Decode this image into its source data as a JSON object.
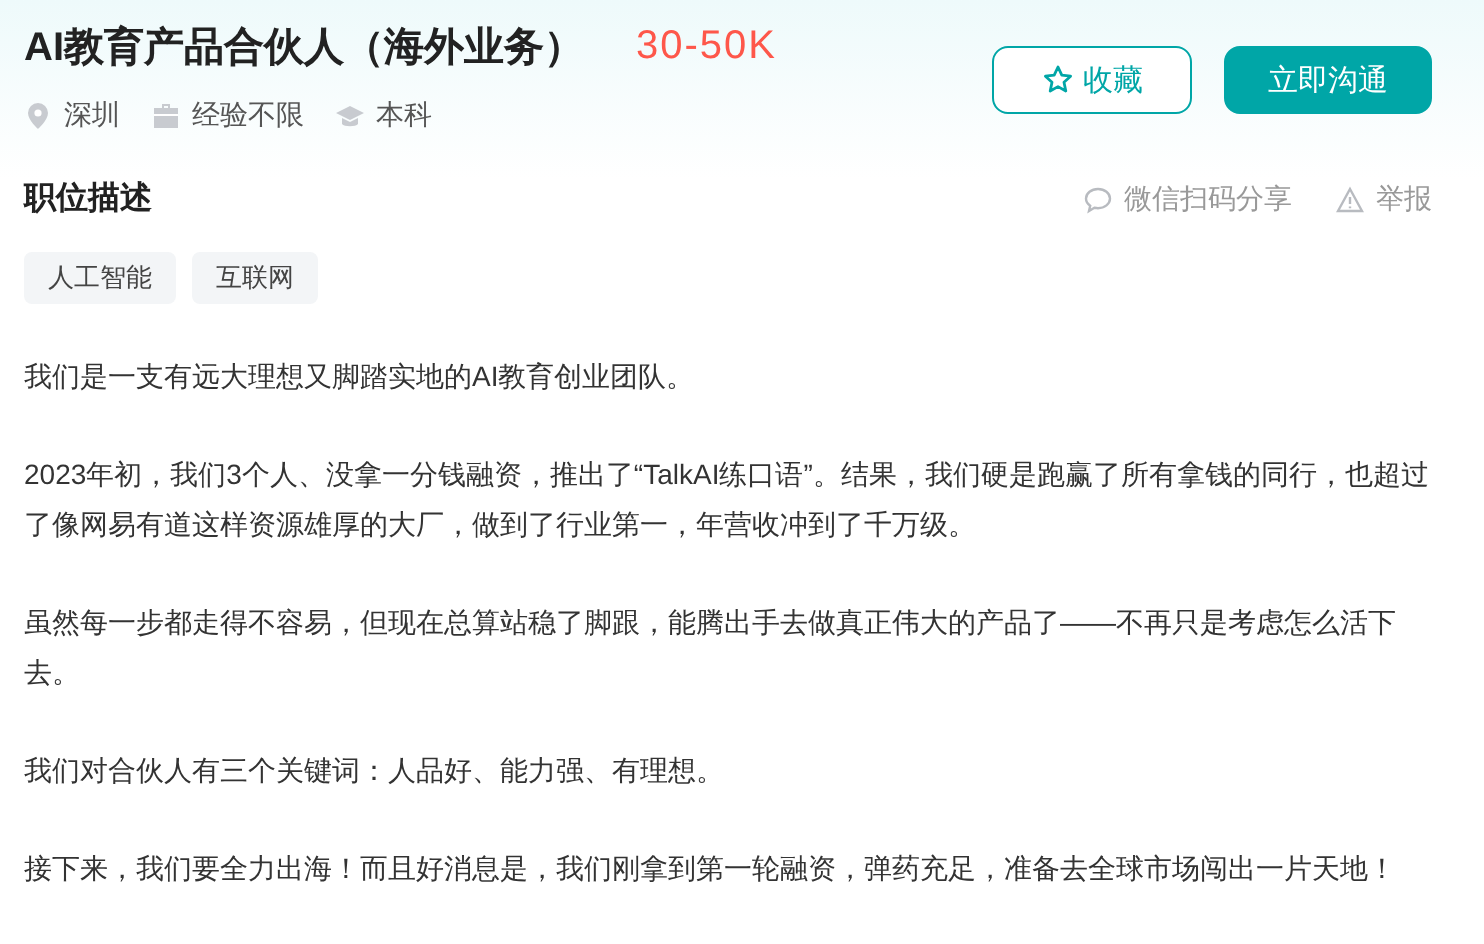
{
  "job": {
    "title": "AI教育产品合伙人（海外业务）",
    "salary": "30-50K",
    "meta": [
      {
        "kind": "location",
        "label": "深圳"
      },
      {
        "kind": "experience",
        "label": "经验不限"
      },
      {
        "kind": "degree",
        "label": "本科"
      }
    ]
  },
  "actions": [
    {
      "kind": "favorite",
      "label": "收藏"
    },
    {
      "kind": "chat",
      "label": "立即沟通"
    }
  ],
  "section": {
    "title": "职位描述",
    "links": [
      {
        "kind": "share",
        "label": "微信扫码分享"
      },
      {
        "kind": "report",
        "label": "举报"
      }
    ]
  },
  "tags": [
    "人工智能",
    "互联网"
  ],
  "paragraphs": [
    "我们是一支有远大理想又脚踏实地的AI教育创业团队。",
    "2023年初，我们3个人、没拿一分钱融资，推出了“TalkAI练口语”。结果，我们硬是跑赢了所有拿钱的同行，也超过了像网易有道这样资源雄厚的大厂，做到了行业第一，年营收冲到了千万级。",
    "虽然每一步都走得不容易，但现在总算站稳了脚跟，能腾出手去做真正伟大的产品了——不再只是考虑怎么活下去。",
    "我们对合伙人有三个关键词：人品好、能力强、有理想。",
    "接下来，我们要全力出海！而且好消息是，我们刚拿到第一轮融资，弹药充足，准备去全球市场闯出一片天地！"
  ]
}
